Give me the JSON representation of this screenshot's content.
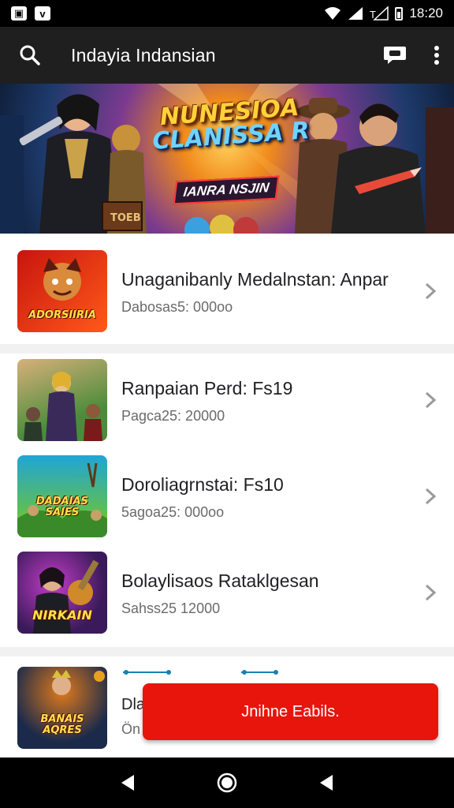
{
  "status_bar": {
    "time": "18:20",
    "icons": [
      "notification-icon",
      "notification-icon",
      "wifi-icon",
      "signal-icon",
      "no-signal-icon",
      "battery-icon"
    ]
  },
  "app_bar": {
    "title": "Indayia Indansian",
    "search_icon": "search-icon",
    "chat_icon": "chat-icon",
    "menu_icon": "more-vert-icon"
  },
  "banner": {
    "title_line1": "NUNESIOA",
    "title_line2": "CLANISSA R",
    "badge": "IANRA NSJIN",
    "crate_label": "TOEB"
  },
  "list": [
    {
      "title": "Unaganibanly Medalnstan: Anpar",
      "subtitle": "Dabosas5: 000oo",
      "thumb_label": "ADORSIIRIA",
      "thumb_colors": [
        "#c8140e",
        "#ff5a1a"
      ]
    },
    {
      "title": "Ranpaian Perd: Fs19",
      "subtitle": "Pagca25: 20000",
      "thumb_label": "",
      "thumb_colors": [
        "#4a8c3a",
        "#d8b07a"
      ]
    },
    {
      "title": "Doroliagrnstai: Fs10",
      "subtitle": "5agoa25: 000oo",
      "thumb_label": "DADAIAS SAIES",
      "thumb_colors": [
        "#1fa5d8",
        "#6ac23c"
      ]
    },
    {
      "title": "Bolaylisaos Rataklgesan",
      "subtitle": "Sahss25 12000",
      "thumb_label": "NIRKAIN",
      "thumb_colors": [
        "#3a1a5a",
        "#c43cc8"
      ]
    },
    {
      "title": "Dla",
      "subtitle": "Ön",
      "thumb_label": "BANAIS AQRES",
      "thumb_colors": [
        "#1b2a4a",
        "#e07a1c"
      ]
    }
  ],
  "cta": {
    "label": "Jnihne Eabils."
  },
  "nav_bar": {
    "back_icon": "back-icon",
    "home_icon": "home-icon",
    "recents_icon": "back-icon"
  }
}
